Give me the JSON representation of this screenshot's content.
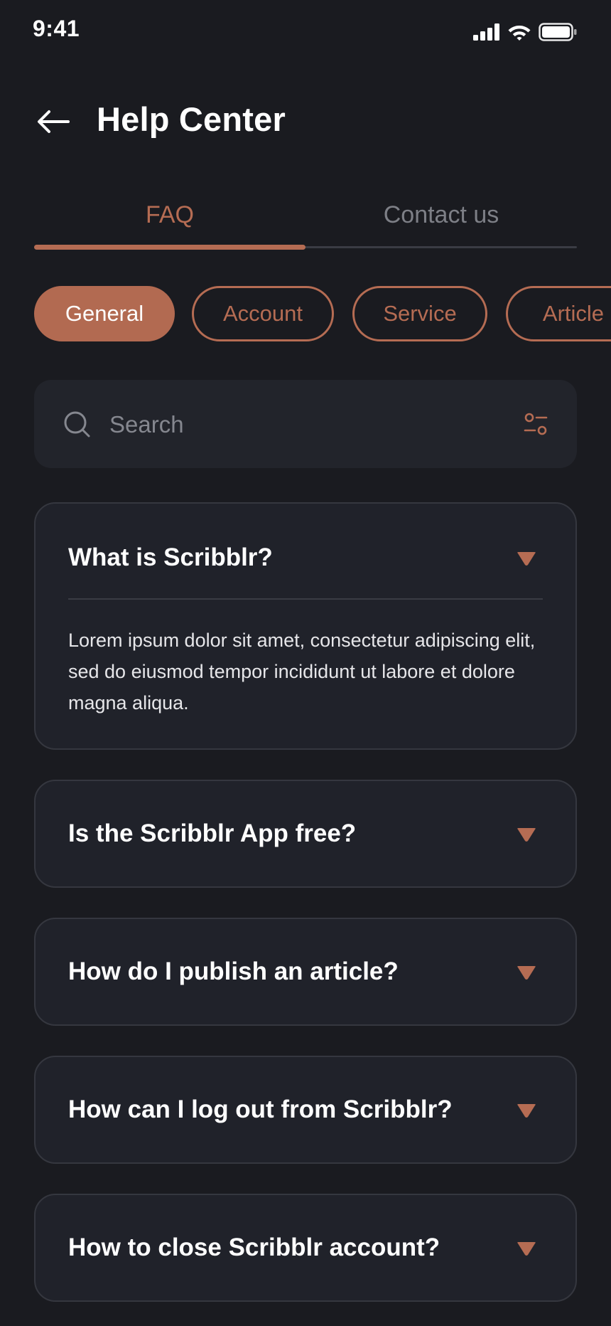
{
  "status_bar": {
    "time": "9:41",
    "icons": [
      "cellular-signal-icon",
      "wifi-icon",
      "battery-icon"
    ]
  },
  "header": {
    "back_icon": "arrow-left-icon",
    "title": "Help Center"
  },
  "tabs": [
    {
      "label": "FAQ",
      "active": true
    },
    {
      "label": "Contact us",
      "active": false
    }
  ],
  "categories": [
    {
      "label": "General",
      "active": true
    },
    {
      "label": "Account",
      "active": false
    },
    {
      "label": "Service",
      "active": false
    },
    {
      "label": "Article",
      "active": false
    }
  ],
  "search": {
    "placeholder": "Search",
    "value": "",
    "icon": "search-icon",
    "filter_icon": "filter-icon"
  },
  "faqs": [
    {
      "question": "What is Scribblr?",
      "answer": "Lorem ipsum dolor sit amet, consectetur adipiscing elit, sed do eiusmod tempor incididunt ut labore et dolore magna aliqua.",
      "expanded": true
    },
    {
      "question": "Is the Scribblr App free?",
      "expanded": false
    },
    {
      "question": "How do I publish an article?",
      "expanded": false
    },
    {
      "question": "How can I log out from Scribblr?",
      "expanded": false
    },
    {
      "question": "How to close Scribblr account?",
      "expanded": false
    }
  ],
  "colors": {
    "background": "#1a1b20",
    "card": "#20222a",
    "accent": "#b56c53",
    "muted_text": "#7d7f86"
  }
}
